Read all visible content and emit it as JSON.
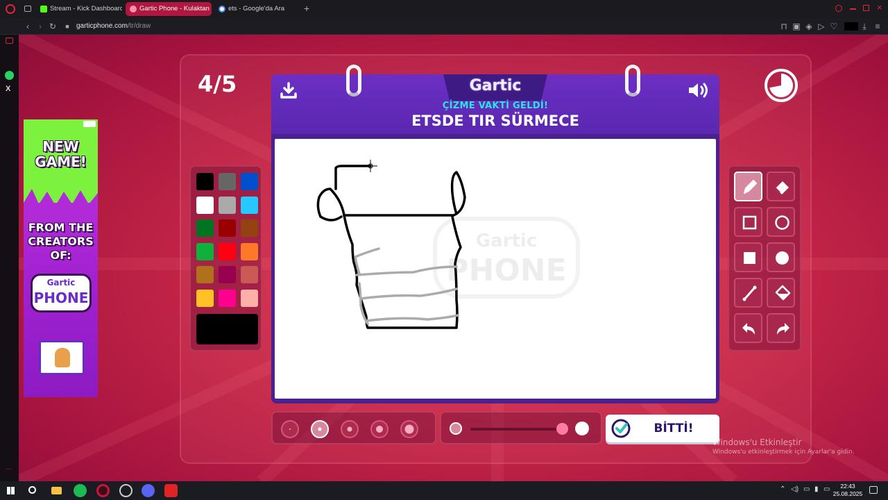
{
  "browser": {
    "tabs": [
      {
        "label": "Stream - Kick Dashboard",
        "icon": "kick-icon",
        "active": false
      },
      {
        "label": "Gartic Phone - Kulaktan K",
        "icon": "gartic-icon",
        "active": true
      },
      {
        "label": "ets - Google'da Ara",
        "icon": "google-icon",
        "active": false
      }
    ],
    "url_host": "garticphone.com",
    "url_path": "/tr/draw"
  },
  "game": {
    "round": "4/5",
    "logo": "Gartic",
    "subtitle": "ÇİZME VAKTİ GELDİ!",
    "prompt": "ETSDE TIR SÜRMECE",
    "done_label": "BİTTİ!",
    "timer_remaining": 0.72,
    "palette": [
      "#000000",
      "#666666",
      "#0050cd",
      "#ffffff",
      "#aaaaaa",
      "#26c9ff",
      "#017420",
      "#990000",
      "#964112",
      "#11b03c",
      "#ff0013",
      "#ff7829",
      "#b0701c",
      "#99004e",
      "#cb5a57",
      "#ffc126",
      "#ff008f",
      "#feafa8"
    ],
    "current_color": "#000000",
    "tools": [
      "pencil-icon",
      "eraser-icon",
      "rectangle-outline-icon",
      "circle-outline-icon",
      "rectangle-fill-icon",
      "circle-fill-icon",
      "line-icon",
      "fill-bucket-icon",
      "undo-icon",
      "redo-icon"
    ],
    "brush_sizes": 5,
    "selected_brush": 2
  },
  "ad": {
    "new_game": "NEW GAME!",
    "from_creators": "FROM THE CREATORS OF:",
    "logo_top": "Gartic",
    "logo_bottom": "PHONE"
  },
  "watermark": {
    "top": "Gartic",
    "bottom": "PHONE"
  },
  "os": {
    "activation_title": "Windows'u Etkinleştir",
    "activation_sub": "Windows'u etkinleştirmek için Ayarlar'a gidin.",
    "time": "22:43",
    "date": "25.08.2025"
  },
  "colors": {
    "accent": "#b0163f",
    "card": "#5a27b0",
    "subtitle": "#29e6e0"
  }
}
